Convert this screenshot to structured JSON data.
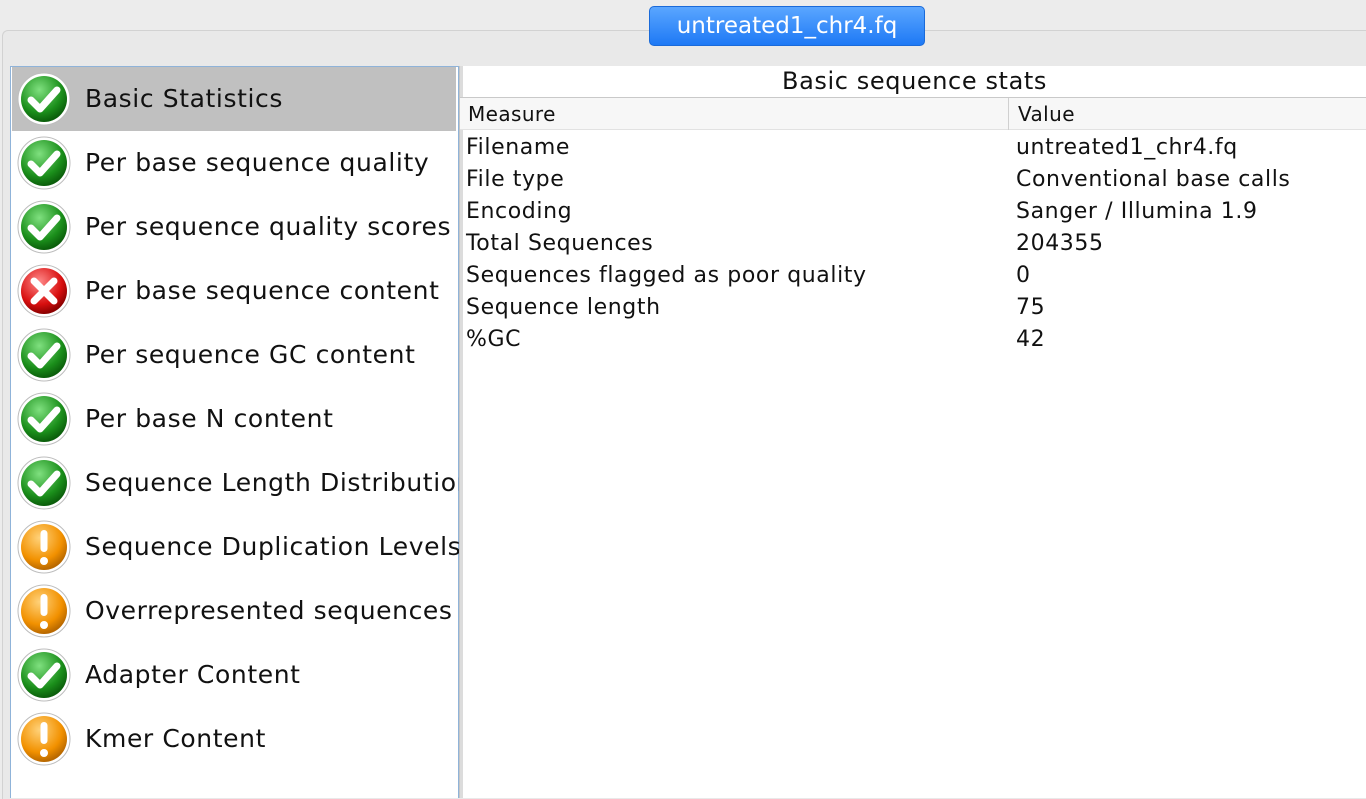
{
  "tab": {
    "title": "untreated1_chr4.fq"
  },
  "modules": [
    {
      "label": "Basic Statistics",
      "status": "pass",
      "selected": true
    },
    {
      "label": "Per base sequence quality",
      "status": "pass"
    },
    {
      "label": "Per sequence quality scores",
      "status": "pass"
    },
    {
      "label": "Per base sequence content",
      "status": "fail"
    },
    {
      "label": "Per sequence GC content",
      "status": "pass"
    },
    {
      "label": "Per base N content",
      "status": "pass"
    },
    {
      "label": "Sequence Length Distribution",
      "status": "pass"
    },
    {
      "label": "Sequence Duplication Levels",
      "status": "warn"
    },
    {
      "label": "Overrepresented sequences",
      "status": "warn"
    },
    {
      "label": "Adapter Content",
      "status": "pass"
    },
    {
      "label": "Kmer Content",
      "status": "warn"
    }
  ],
  "status_icons": {
    "pass": "check-icon",
    "fail": "cross-icon",
    "warn": "exclamation-icon"
  },
  "colors": {
    "pass": "#1e9e1e",
    "fail": "#e01010",
    "warn": "#f59a00",
    "tab": "#2b86f8"
  },
  "table": {
    "title": "Basic sequence stats",
    "columns": [
      "Measure",
      "Value"
    ],
    "rows": [
      [
        "Filename",
        "untreated1_chr4.fq"
      ],
      [
        "File type",
        "Conventional base calls"
      ],
      [
        "Encoding",
        "Sanger / Illumina 1.9"
      ],
      [
        "Total Sequences",
        "204355"
      ],
      [
        "Sequences flagged as poor quality",
        "0"
      ],
      [
        "Sequence length",
        "75"
      ],
      [
        "%GC",
        "42"
      ]
    ]
  }
}
